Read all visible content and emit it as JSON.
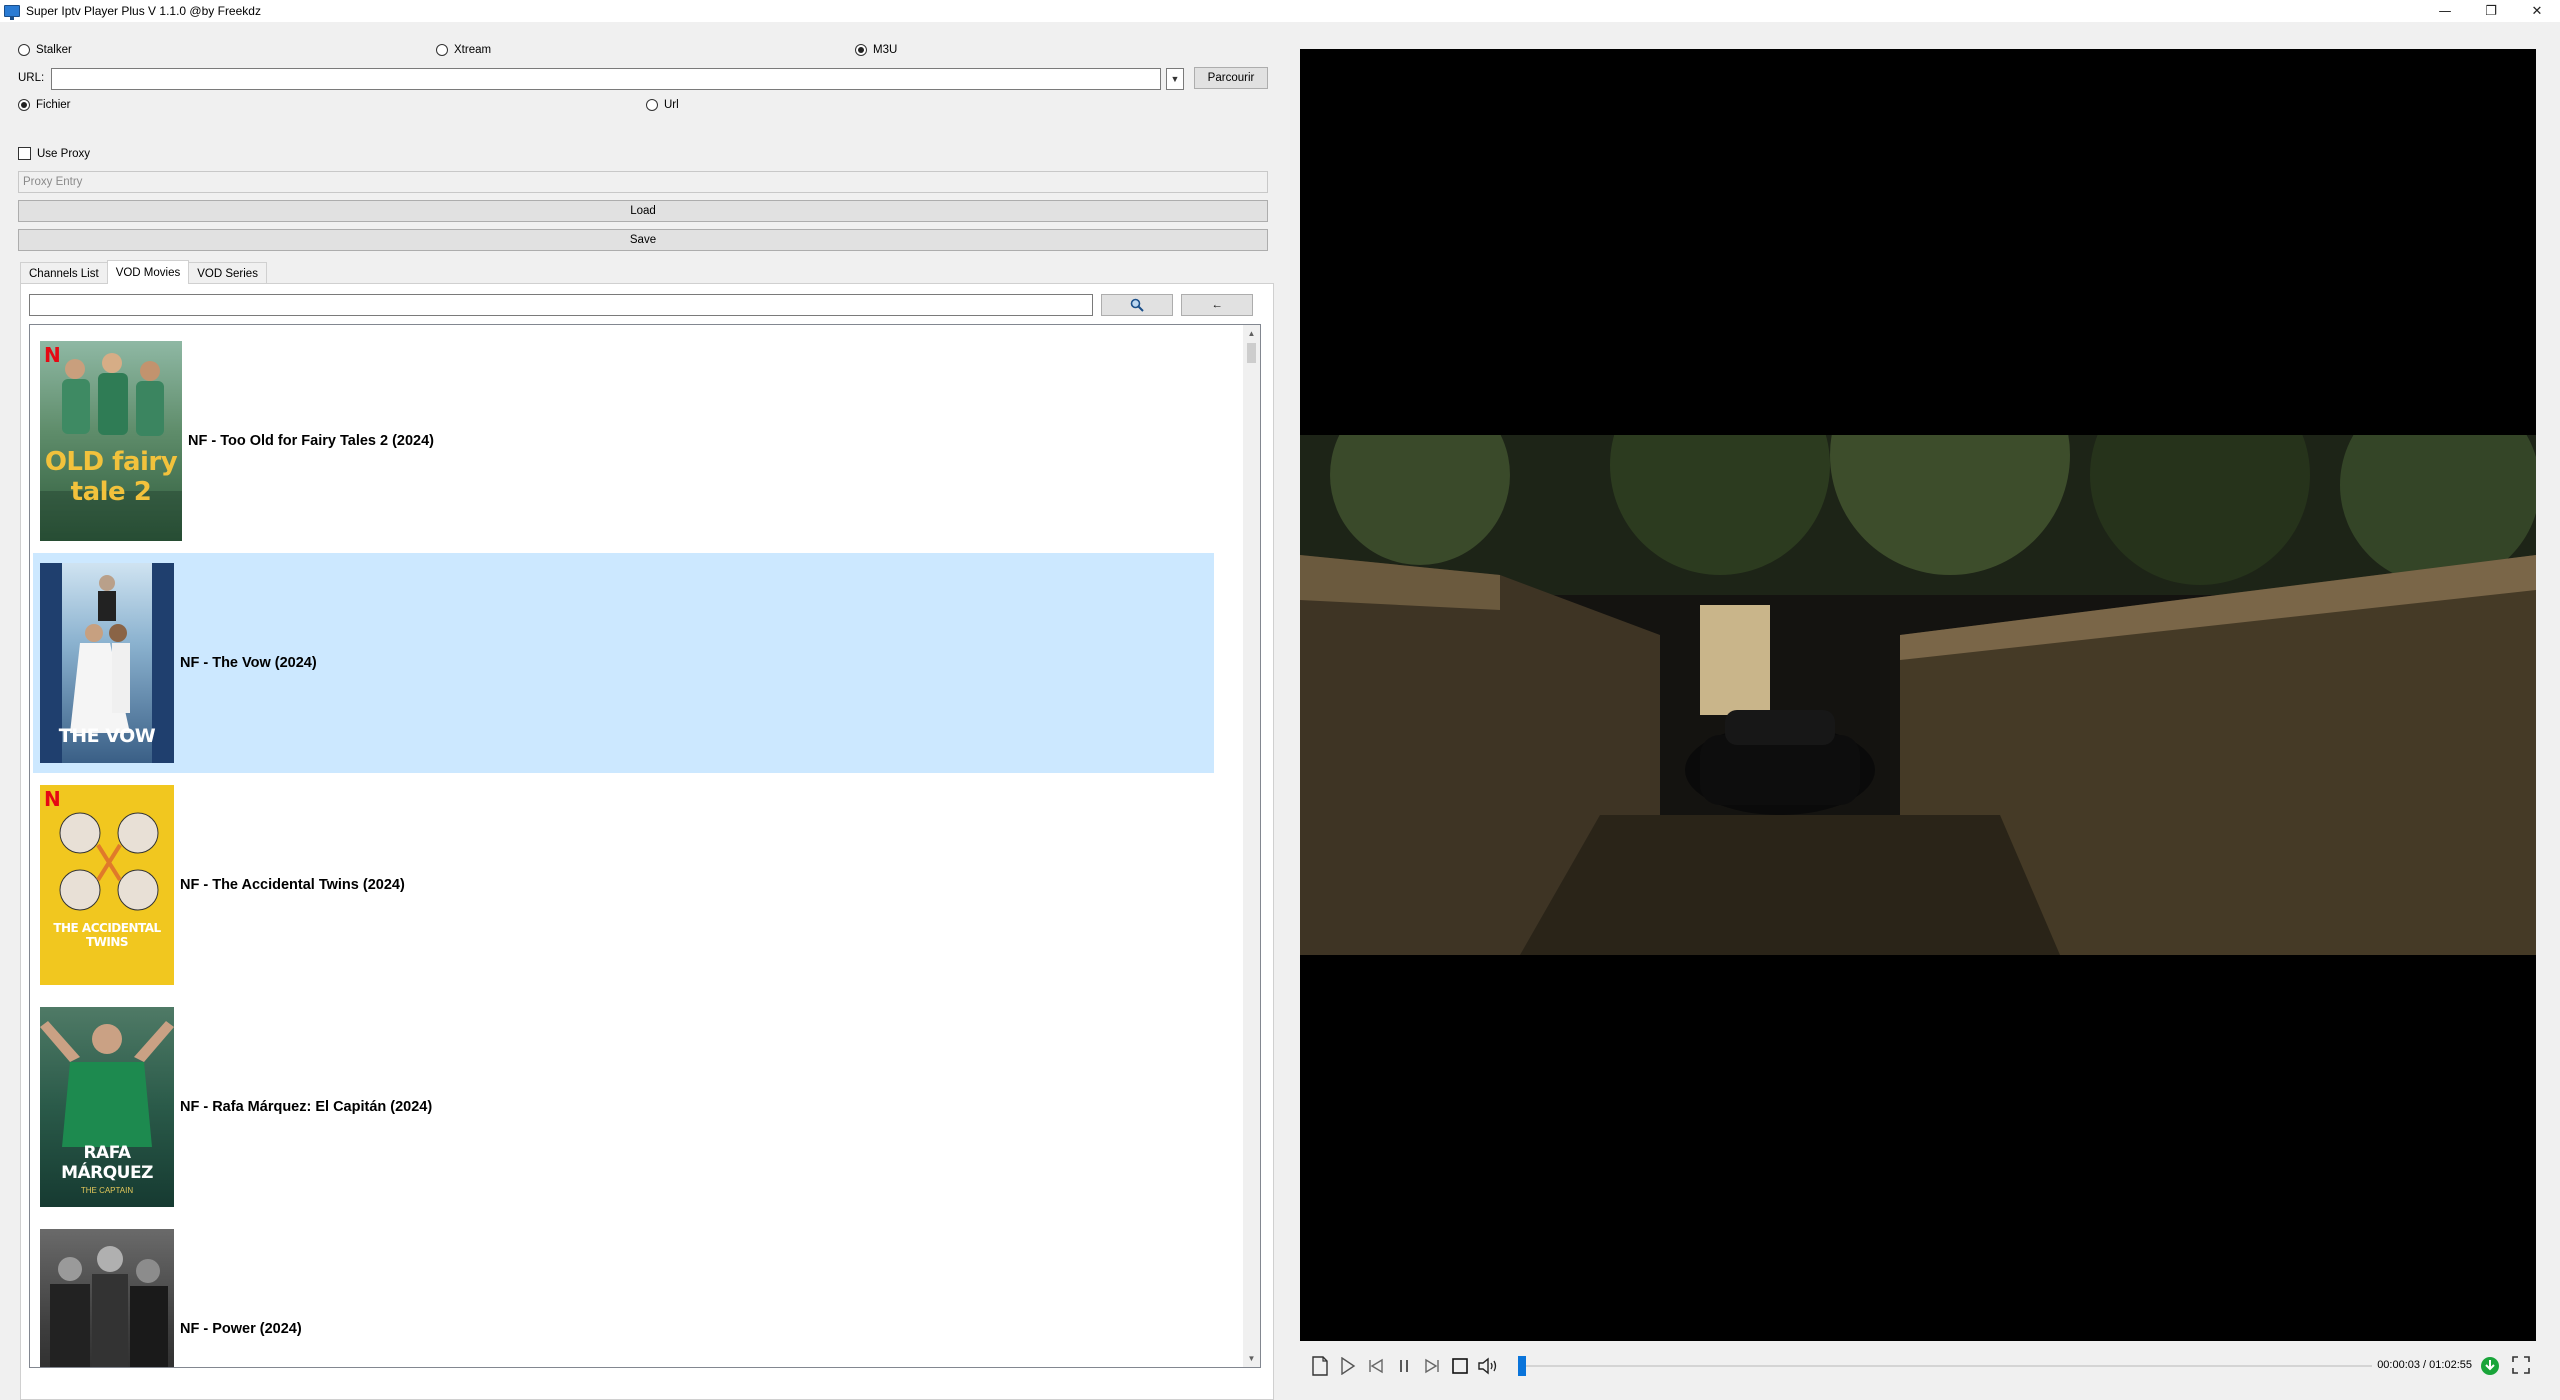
{
  "window": {
    "title": "Super Iptv Player Plus V 1.1.0 @by Freekdz",
    "minimize": "—",
    "restore": "❐",
    "close": "✕"
  },
  "source": {
    "stalker_label": "Stalker",
    "xtream_label": "Xtream",
    "m3u_label": "M3U",
    "selected": "M3U",
    "url_label": "URL:",
    "url_value": "",
    "browse_label": "Parcourir",
    "fichier_label": "Fichier",
    "url_option_label": "Url",
    "selected_input": "Fichier"
  },
  "proxy": {
    "use_proxy_label": "Use Proxy",
    "checked": false,
    "placeholder": "Proxy Entry"
  },
  "actions": {
    "load_label": "Load",
    "save_label": "Save"
  },
  "tabs": [
    {
      "label": "Channels List",
      "active": false
    },
    {
      "label": "VOD Movies",
      "active": true
    },
    {
      "label": "VOD Series",
      "active": false
    }
  ],
  "search": {
    "value": "",
    "search_icon": "magnifier-icon",
    "back_label": "←"
  },
  "movies": [
    {
      "title": "NF - Too Old for Fairy Tales 2 (2024)",
      "poster_text": "OLD fairy tale 2",
      "selected": false
    },
    {
      "title": "NF - The Vow (2024)",
      "poster_text": "THE VOW",
      "selected": true
    },
    {
      "title": "NF - The Accidental Twins (2024)",
      "poster_text": "THE ACCIDENTAL TWINS",
      "selected": false
    },
    {
      "title": "NF - Rafa Márquez: El Capitán (2024)",
      "poster_text": "RAFA MÁRQUEZ",
      "poster_sub": "THE CAPTAIN",
      "selected": false
    },
    {
      "title": "NF - Power (2024)",
      "poster_text": "",
      "selected": false
    }
  ],
  "player": {
    "time_current": "00:00:03",
    "time_total": "01:02:55",
    "time_display": "00:00:03 / 01:02:55",
    "progress": 0.001
  },
  "colors": {
    "selection": "#cce8ff",
    "seek_accent": "#0a74da",
    "netflix_red": "#e50914"
  }
}
